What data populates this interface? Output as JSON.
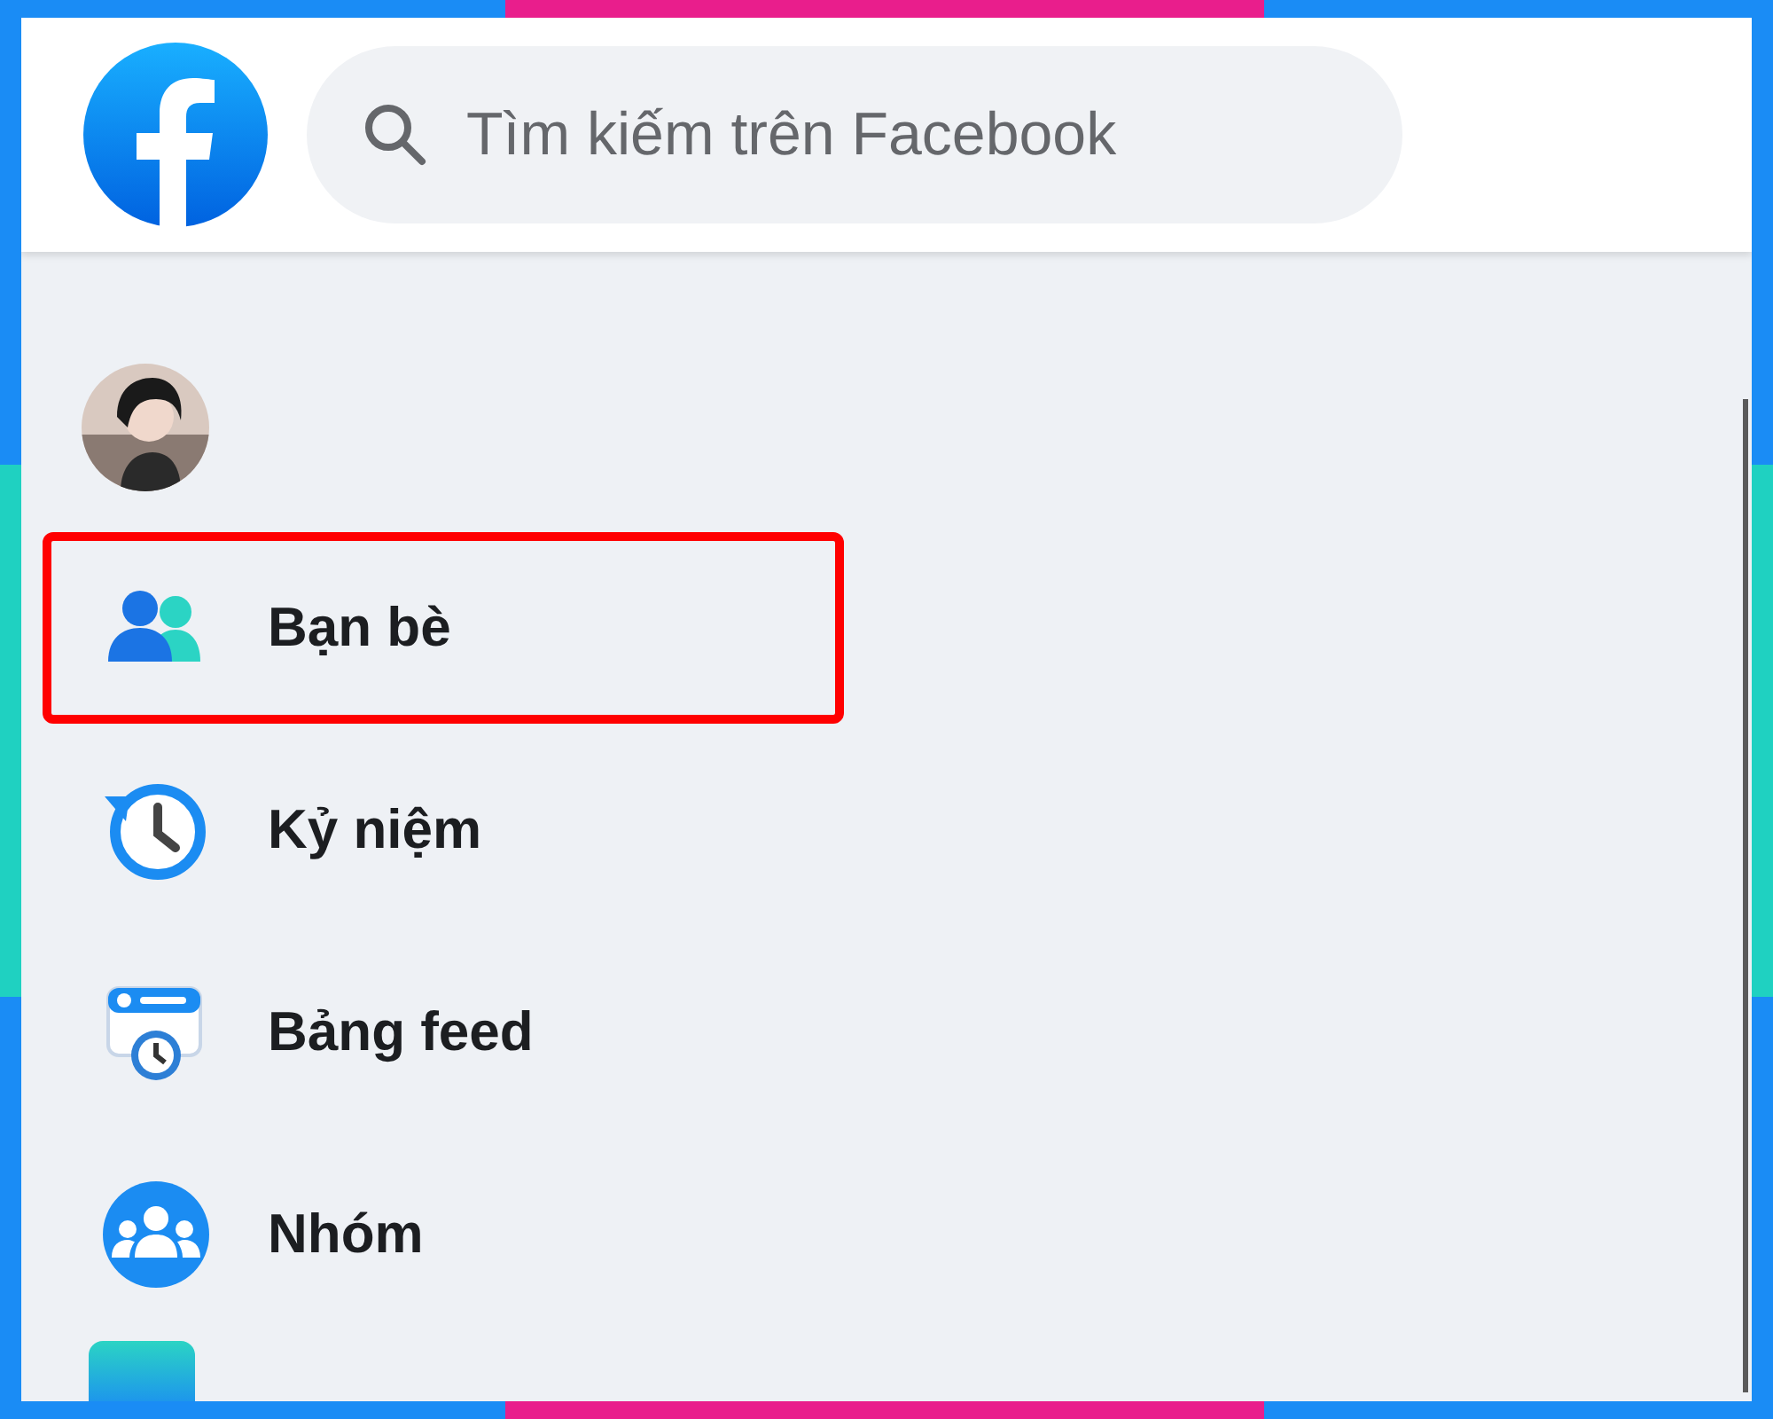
{
  "search": {
    "placeholder": "Tìm kiếm trên Facebook"
  },
  "menu": [
    {
      "kind": "friends",
      "label": "Bạn bè",
      "highlighted": true
    },
    {
      "kind": "memories",
      "label": "Kỷ niệm",
      "highlighted": false
    },
    {
      "kind": "feed",
      "label": "Bảng feed",
      "highlighted": false
    },
    {
      "kind": "groups",
      "label": "Nhóm",
      "highlighted": false
    }
  ]
}
